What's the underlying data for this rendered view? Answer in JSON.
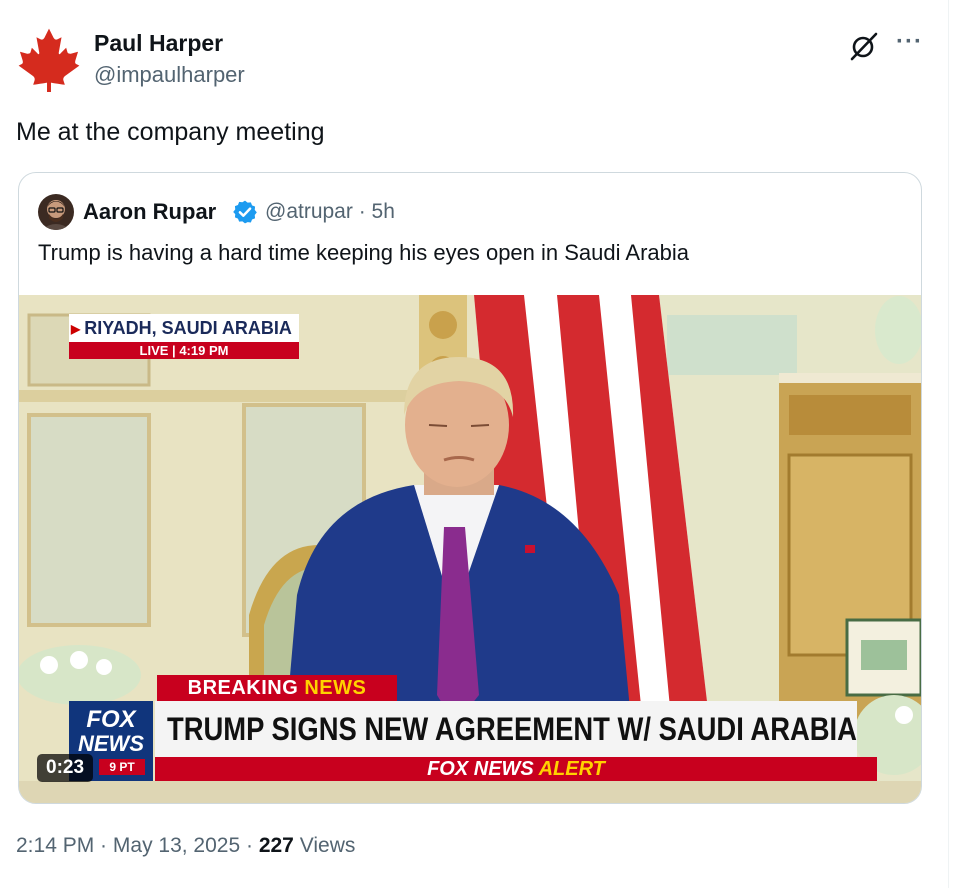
{
  "tweet": {
    "author_name": "Paul Harper",
    "author_handle": "@impaulharper",
    "text": "Me at the company meeting",
    "time": "2:14 PM",
    "date": "May 13, 2025",
    "views_count": "227",
    "views_label": "Views"
  },
  "quote": {
    "author_name": "Aaron Rupar",
    "author_handle": "@atrupar",
    "age": "5h",
    "text": "Trump is having a hard time keeping his eyes open in Saudi Arabia",
    "video": {
      "duration": "0:23",
      "location": "RIYADH, SAUDI ARABIA",
      "live_label": "LIVE",
      "live_time": "4:19 PM",
      "breaking_1": "BREAKING",
      "breaking_2": "NEWS",
      "headline": "TRUMP SIGNS NEW AGREEMENT W/ SAUDI ARABIA",
      "alert_1": "FOX NEWS",
      "alert_2": "ALERT",
      "logo_1": "FOX",
      "logo_2": "NEWS",
      "logo_3": "9 PT"
    }
  },
  "colors": {
    "text_primary": "#0f1419",
    "text_secondary": "#536471",
    "border": "#cfd9de",
    "verified_blue": "#1d9bf0",
    "flag_red": "#d52b1e",
    "fox_red": "#c8001e",
    "fox_blue": "#10357c"
  },
  "icons": {
    "avatar": "maple-leaf-icon",
    "grok": "grok-icon",
    "more": "more-horizontal-icon",
    "verified": "verified-badge-icon"
  }
}
